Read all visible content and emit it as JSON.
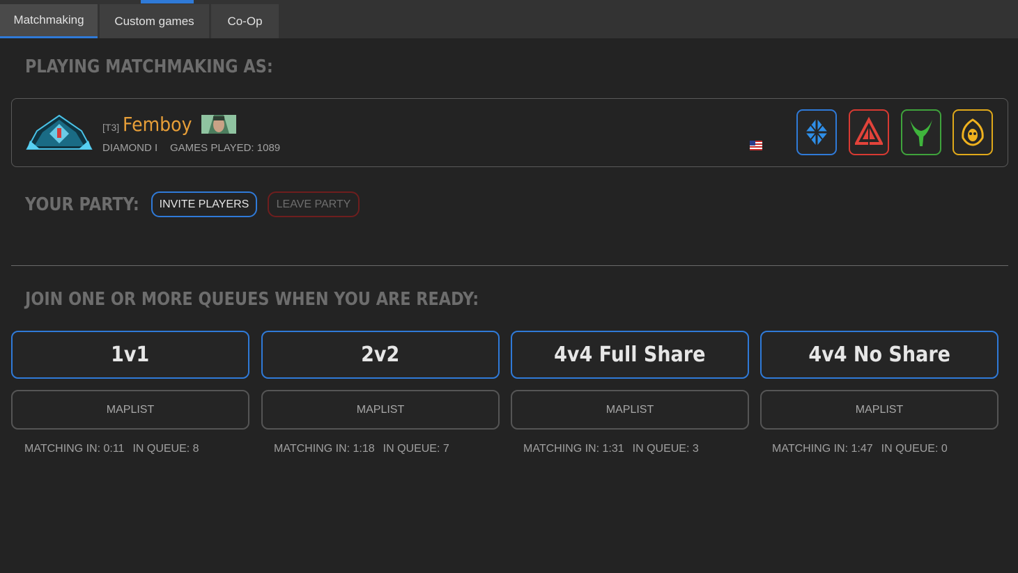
{
  "tabs": [
    {
      "label": "Matchmaking",
      "active": true
    },
    {
      "label": "Custom games",
      "active": false
    },
    {
      "label": "Co-Op",
      "active": false
    }
  ],
  "headings": {
    "playing_as": "PLAYING MATCHMAKING AS:",
    "party": "YOUR PARTY:",
    "queues": "JOIN ONE OR MORE QUEUES WHEN YOU ARE READY:"
  },
  "player": {
    "clan_tag": "[T3]",
    "name": "Femboy",
    "rank": "DIAMOND I",
    "games_played": "GAMES PLAYED: 1089",
    "rank_emblem_icon": "diamond-rank-emblem",
    "portrait_icon": "player-portrait",
    "flag_icon": "us-flag"
  },
  "factions": [
    {
      "name": "uef",
      "icon": "uef-faction-icon",
      "color": "#2f7ad8"
    },
    {
      "name": "cybran",
      "icon": "cybran-faction-icon",
      "color": "#d83a32"
    },
    {
      "name": "aeon",
      "icon": "aeon-faction-icon",
      "color": "#3fa33c"
    },
    {
      "name": "seraphim",
      "icon": "seraphim-faction-icon",
      "color": "#e0a91a"
    }
  ],
  "party": {
    "invite_label": "INVITE PLAYERS",
    "leave_label": "LEAVE PARTY"
  },
  "queues": [
    {
      "label": "1v1",
      "maplist": "MAPLIST",
      "matching": "MATCHING IN: 0:11",
      "in_queue": "IN QUEUE: 8"
    },
    {
      "label": "2v2",
      "maplist": "MAPLIST",
      "matching": "MATCHING IN: 1:18",
      "in_queue": "IN QUEUE: 7"
    },
    {
      "label": "4v4 Full Share",
      "maplist": "MAPLIST",
      "matching": "MATCHING IN: 1:31",
      "in_queue": "IN QUEUE: 3"
    },
    {
      "label": "4v4 No Share",
      "maplist": "MAPLIST",
      "matching": "MATCHING IN: 1:47",
      "in_queue": "IN QUEUE: 0"
    }
  ],
  "colors": {
    "accent_blue": "#2f7ad8",
    "leave_red": "#6e1e1e",
    "player_name": "#e79e38",
    "background": "#232323"
  }
}
